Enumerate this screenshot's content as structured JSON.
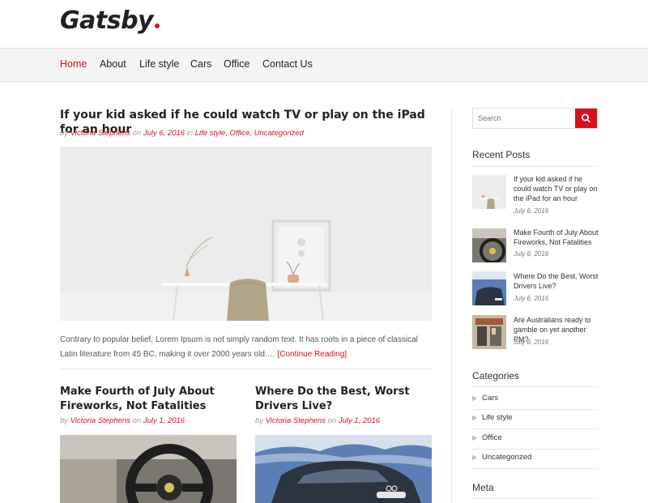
{
  "site": {
    "name": "Gatsby"
  },
  "nav": {
    "items": [
      "Home",
      "About",
      "Life style",
      "Cars",
      "Office",
      "Contact Us"
    ]
  },
  "featured_post": {
    "title": "If your kid asked if he could watch TV or play on the iPad for an hour",
    "meta": {
      "by": "by",
      "author": "Victoria Stephens",
      "on": "on",
      "date": "July 6, 2016",
      "in": "in",
      "categories": "Life style, Office, Uncategorized"
    },
    "excerpt": "Contrary to popular belief, Lorem Ipsum is not simply random text. It has roots in a piece of classical Latin literature from 45 BC, making it over 2000 years old.…",
    "read_more": "[Continue Reading]"
  },
  "grid_posts": [
    {
      "title": "Make Fourth of July About Fireworks, Not Fatalities",
      "meta": {
        "by": "by",
        "author": "Victoria Stephens",
        "on": "on",
        "date": "July 1, 2016"
      }
    },
    {
      "title": "Where Do the Best, Worst Drivers Live?",
      "meta": {
        "by": "by",
        "author": "Victoria Stephens",
        "on": "on",
        "date": "July 1, 2016"
      }
    }
  ],
  "sidebar": {
    "search": {
      "placeholder": "Search",
      "icon": "search-icon"
    },
    "recent_posts": {
      "title": "Recent Posts",
      "items": [
        {
          "title": "If your kid asked if he could watch TV or play on the iPad for an hour",
          "date": "July 6, 2016"
        },
        {
          "title": "Make Fourth of July About Fireworks, Not Fatalities",
          "date": "July 6, 2016"
        },
        {
          "title": "Where Do the Best, Worst Drivers Live?",
          "date": "July 6, 2016"
        },
        {
          "title": "Are Australians ready to gamble on yet another PM?",
          "date": "July 6, 2016"
        }
      ]
    },
    "categories": {
      "title": "Categories",
      "items": [
        "Cars",
        "Life style",
        "Office",
        "Uncategorized"
      ]
    },
    "meta": {
      "title": "Meta"
    }
  },
  "colors": {
    "accent": "#d8101e",
    "nav_bg": "#f4f4f4",
    "text": "#222222",
    "meta": "#999999"
  }
}
